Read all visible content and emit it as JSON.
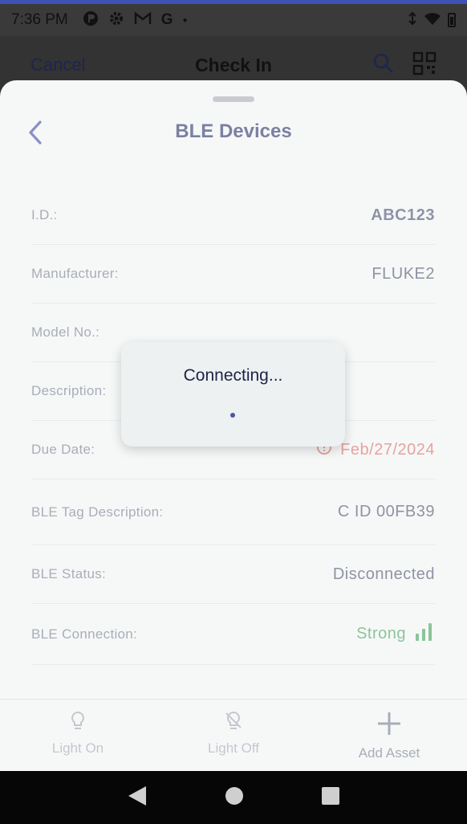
{
  "status_bar": {
    "time": "7:36 PM",
    "icons": [
      "app-icon",
      "settings-icon",
      "gmail-icon",
      "google-icon",
      "dot-icon"
    ],
    "right_icons": [
      "vibrate-icon",
      "wifi-icon",
      "battery-icon"
    ]
  },
  "app_bar": {
    "cancel_label": "Cancel",
    "title": "Check In",
    "actions": [
      "search-icon",
      "qr-code-icon"
    ]
  },
  "sheet": {
    "title": "BLE Devices",
    "rows": [
      {
        "label": "I.D.:",
        "value": "ABC123"
      },
      {
        "label": "Manufacturer:",
        "value": "FLUKE2"
      },
      {
        "label": "Model No.:",
        "value": ""
      },
      {
        "label": "Description:",
        "value": ""
      },
      {
        "label": "Due Date:",
        "value": "Feb/27/2024"
      },
      {
        "label": "BLE Tag Description:",
        "value": "C ID 00FB39"
      },
      {
        "label": "BLE Status:",
        "value": "Disconnected"
      },
      {
        "label": "BLE Connection:",
        "value": "Strong"
      }
    ]
  },
  "dialog": {
    "title": "Connecting..."
  },
  "bottom_bar": {
    "light_on": "Light On",
    "light_off": "Light Off",
    "add_asset": "Add Asset"
  },
  "colors": {
    "accent": "#3f51b5",
    "due_date": "#e8a29d",
    "strong": "#8cc49a",
    "title": "#7c80a3"
  }
}
